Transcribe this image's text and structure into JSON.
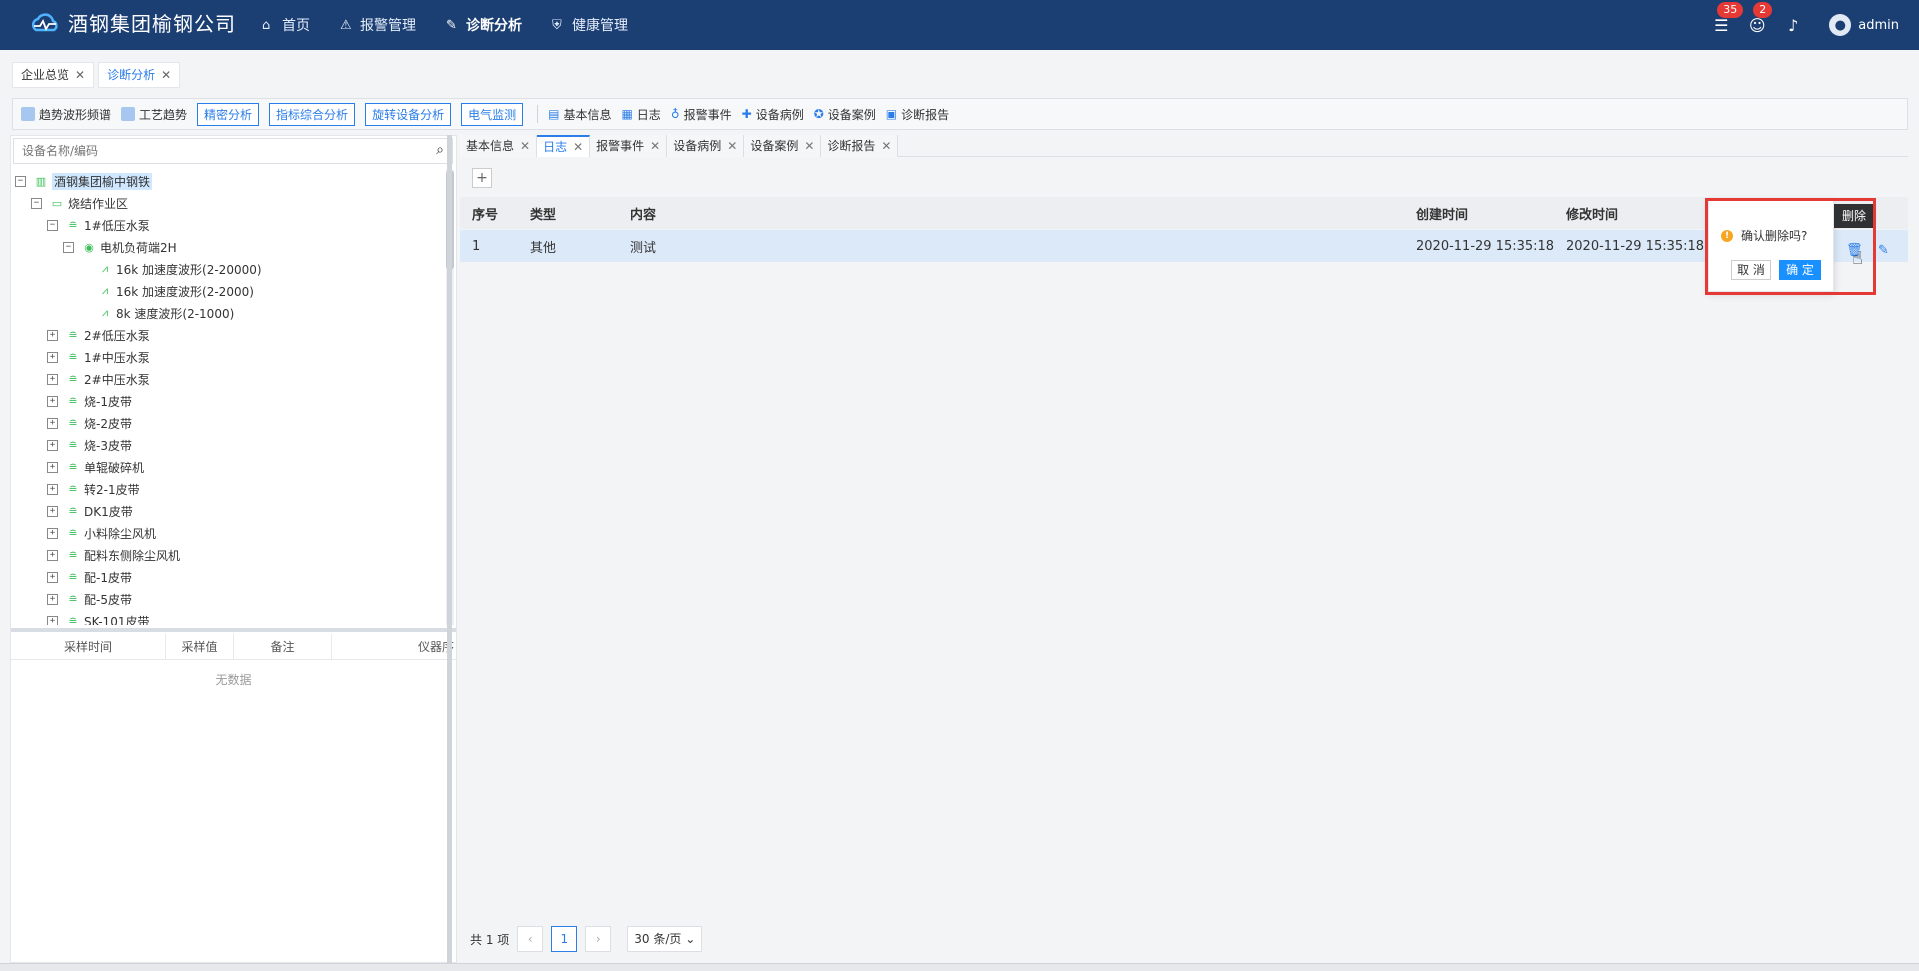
{
  "header": {
    "logo_text": "酒钢集团榆钢公司",
    "nav": [
      {
        "label": "首页",
        "icon": "home-icon"
      },
      {
        "label": "报警管理",
        "icon": "alarm-icon"
      },
      {
        "label": "诊断分析",
        "icon": "wrench-icon"
      },
      {
        "label": "健康管理",
        "icon": "shield-icon"
      }
    ],
    "badge_alarm": "35",
    "badge_user": "2",
    "username": "admin"
  },
  "page_tabs": [
    {
      "label": "企业总览"
    },
    {
      "label": "诊断分析"
    }
  ],
  "toolbar": {
    "plain1": "趋势波形频谱",
    "plain2": "工艺趋势",
    "buttons": [
      "精密分析",
      "指标综合分析",
      "旋转设备分析",
      "电气监测"
    ],
    "links": [
      "基本信息",
      "日志",
      "报警事件",
      "设备病例",
      "设备案例",
      "诊断报告"
    ]
  },
  "search": {
    "placeholder": "设备名称/编码"
  },
  "tree": [
    {
      "label": "酒钢集团榆中钢铁",
      "level": 0,
      "toggle": "−"
    },
    {
      "label": "烧结作业区",
      "level": 1,
      "toggle": "−"
    },
    {
      "label": "1#低压水泵",
      "level": 2,
      "toggle": "−"
    },
    {
      "label": "电机负荷端2H",
      "level": 3,
      "toggle": "−"
    },
    {
      "label": "16k 加速度波形(2-20000)",
      "level": 4,
      "toggle": ""
    },
    {
      "label": "16k 加速度波形(2-2000)",
      "level": 4,
      "toggle": ""
    },
    {
      "label": "8k 速度波形(2-1000)",
      "level": 4,
      "toggle": ""
    },
    {
      "label": "2#低压水泵",
      "level": 2,
      "toggle": "+"
    },
    {
      "label": "1#中压水泵",
      "level": 2,
      "toggle": "+"
    },
    {
      "label": "2#中压水泵",
      "level": 2,
      "toggle": "+"
    },
    {
      "label": "烧-1皮带",
      "level": 2,
      "toggle": "+"
    },
    {
      "label": "烧-2皮带",
      "level": 2,
      "toggle": "+"
    },
    {
      "label": "烧-3皮带",
      "level": 2,
      "toggle": "+"
    },
    {
      "label": "单辊破碎机",
      "level": 2,
      "toggle": "+"
    },
    {
      "label": "转2-1皮带",
      "level": 2,
      "toggle": "+"
    },
    {
      "label": "DK1皮带",
      "level": 2,
      "toggle": "+"
    },
    {
      "label": "小料除尘风机",
      "level": 2,
      "toggle": "+"
    },
    {
      "label": "配料东侧除尘风机",
      "level": 2,
      "toggle": "+"
    },
    {
      "label": "配-1皮带",
      "level": 2,
      "toggle": "+"
    },
    {
      "label": "配-5皮带",
      "level": 2,
      "toggle": "+"
    },
    {
      "label": "SK-101皮带",
      "level": 2,
      "toggle": "+"
    }
  ],
  "sample_table": {
    "headers": [
      "采样时间",
      "采样值",
      "备注",
      "仪器序"
    ],
    "empty_text": "无数据"
  },
  "right_tabs": [
    {
      "label": "基本信息"
    },
    {
      "label": "日志"
    },
    {
      "label": "报警事件"
    },
    {
      "label": "设备病例"
    },
    {
      "label": "设备案例"
    },
    {
      "label": "诊断报告"
    }
  ],
  "add_label": "+",
  "grid": {
    "headers": {
      "no": "序号",
      "type": "类型",
      "content": "内容",
      "created": "创建时间",
      "modified": "修改时间"
    },
    "rows": [
      {
        "no": "1",
        "type": "其他",
        "content": "测试",
        "created": "2020-11-29 15:35:18",
        "modified": "2020-11-29 15:35:18"
      }
    ]
  },
  "popconfirm": {
    "message": "确认删除吗?",
    "cancel": "取 消",
    "ok": "确 定"
  },
  "tooltip": "删除",
  "pager": {
    "total": "共 1 项",
    "current": "1",
    "size": "30 条/页"
  }
}
